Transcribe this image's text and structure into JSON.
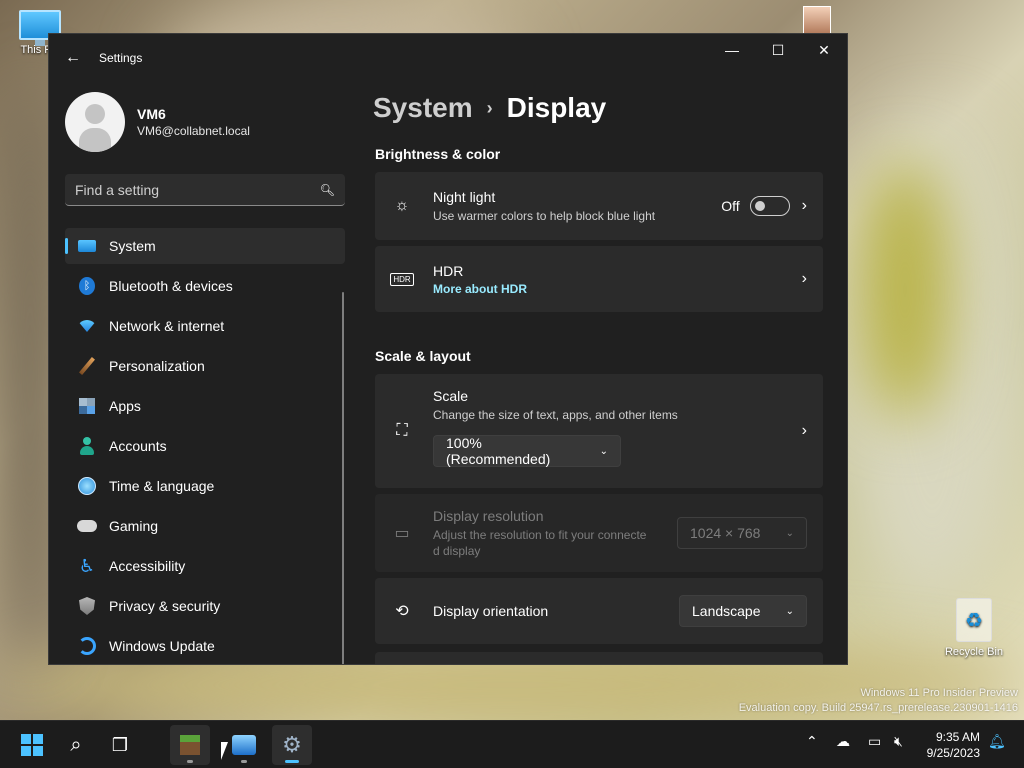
{
  "desktop": {
    "this_pc_label": "This PC",
    "recycle_label": "Recycle Bin",
    "watermark_line1": "Windows 11 Pro Insider Preview",
    "watermark_line2": "Evaluation copy. Build 25947.rs_prerelease.230901-1416"
  },
  "window": {
    "title": "Settings",
    "back_icon": "back-arrow-icon",
    "minimize_glyph": "—",
    "maximize_glyph": "☐",
    "close_glyph": "✕"
  },
  "user": {
    "name": "VM6",
    "email": "VM6@collabnet.local"
  },
  "search": {
    "placeholder": "Find a setting"
  },
  "nav": [
    {
      "label": "System",
      "icon": "system-icon",
      "selected": true
    },
    {
      "label": "Bluetooth & devices",
      "icon": "bluetooth-icon"
    },
    {
      "label": "Network & internet",
      "icon": "wifi-icon"
    },
    {
      "label": "Personalization",
      "icon": "brush-icon"
    },
    {
      "label": "Apps",
      "icon": "apps-icon"
    },
    {
      "label": "Accounts",
      "icon": "accounts-icon"
    },
    {
      "label": "Time & language",
      "icon": "globe-clock-icon"
    },
    {
      "label": "Gaming",
      "icon": "gamepad-icon"
    },
    {
      "label": "Accessibility",
      "icon": "accessibility-icon"
    },
    {
      "label": "Privacy & security",
      "icon": "shield-icon"
    },
    {
      "label": "Windows Update",
      "icon": "update-icon"
    }
  ],
  "breadcrumb": {
    "parent": "System",
    "separator": "›",
    "current": "Display"
  },
  "sections": {
    "brightness_title": "Brightness & color",
    "scale_title": "Scale & layout"
  },
  "night_light": {
    "title": "Night light",
    "subtitle": "Use warmer colors to help block blue light",
    "state": "Off"
  },
  "hdr": {
    "title": "HDR",
    "link": "More about HDR"
  },
  "scale": {
    "title": "Scale",
    "subtitle": "Change the size of text, apps, and other items",
    "value": "100% (Recommended)"
  },
  "resolution": {
    "title": "Display resolution",
    "subtitle_line1": "Adjust the resolution to fit your connecte",
    "subtitle_line2": "d display",
    "value": "1024 × 768"
  },
  "orientation": {
    "title": "Display orientation",
    "value": "Landscape"
  },
  "taskbar": {
    "time": "9:35 AM",
    "date": "9/25/2023"
  },
  "colors": {
    "accent": "#4cc2ff",
    "window_bg": "#202020",
    "card_bg": "#2b2b2b",
    "link": "#99ebff"
  }
}
